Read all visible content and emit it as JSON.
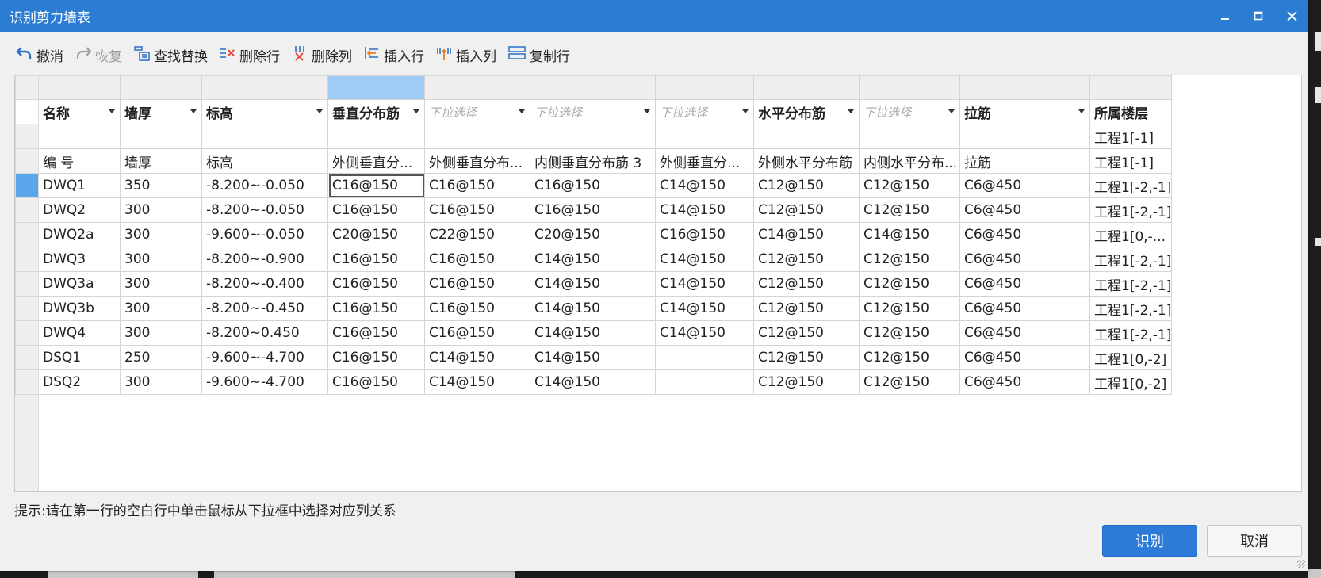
{
  "window": {
    "title": "识别剪力墙表",
    "controls": [
      "minimize-icon",
      "maximize-icon",
      "close-icon"
    ]
  },
  "toolbar": [
    {
      "label": "撤消",
      "icon": "undo-icon",
      "enabled": true
    },
    {
      "label": "恢复",
      "icon": "redo-icon",
      "enabled": false
    },
    {
      "label": "查找替换",
      "icon": "find-replace-icon",
      "enabled": true
    },
    {
      "label": "删除行",
      "icon": "delete-row-icon",
      "enabled": true
    },
    {
      "label": "删除列",
      "icon": "delete-column-icon",
      "enabled": true
    },
    {
      "label": "插入行",
      "icon": "insert-row-icon",
      "enabled": true
    },
    {
      "label": "插入列",
      "icon": "insert-column-icon",
      "enabled": true
    },
    {
      "label": "复制行",
      "icon": "copy-row-icon",
      "enabled": true
    }
  ],
  "table": {
    "mapping_row": [
      {
        "label": "名称",
        "placeholder": false
      },
      {
        "label": "墙厚",
        "placeholder": false
      },
      {
        "label": "标高",
        "placeholder": false
      },
      {
        "label": "垂直分布筋",
        "placeholder": false
      },
      {
        "label": "下拉选择",
        "placeholder": true
      },
      {
        "label": "下拉选择",
        "placeholder": true
      },
      {
        "label": "下拉选择",
        "placeholder": true
      },
      {
        "label": "水平分布筋",
        "placeholder": false
      },
      {
        "label": "下拉选择",
        "placeholder": true
      },
      {
        "label": "拉筋",
        "placeholder": false
      },
      {
        "label": "所属楼层",
        "placeholder": false,
        "no_dropdown": true
      }
    ],
    "blank_row": [
      "",
      "",
      "",
      "",
      "",
      "",
      "",
      "",
      "",
      "",
      "工程1[-1]"
    ],
    "source_header_row": [
      "编 号",
      "墙厚",
      "标高",
      "外侧垂直分...",
      "外侧垂直分布...",
      "内侧垂直分布筋 3",
      "外侧垂直分...",
      "外侧水平分布筋",
      "内侧水平分布...",
      "拉筋",
      "工程1[-1]"
    ],
    "rows": [
      [
        "DWQ1",
        "350",
        "-8.200~-0.050",
        "C16@150",
        "C16@150",
        "C16@150",
        "C14@150",
        "C12@150",
        "C12@150",
        "C6@450",
        "工程1[-2,-1]"
      ],
      [
        "DWQ2",
        "300",
        "-8.200~-0.050",
        "C16@150",
        "C16@150",
        "C16@150",
        "C14@150",
        "C12@150",
        "C12@150",
        "C6@450",
        "工程1[-2,-1]"
      ],
      [
        "DWQ2a",
        "300",
        "-9.600~-0.050",
        "C20@150",
        "C22@150",
        "C20@150",
        "C16@150",
        "C14@150",
        "C14@150",
        "C6@450",
        "工程1[0,-..."
      ],
      [
        "DWQ3",
        "300",
        "-8.200~-0.900",
        "C16@150",
        "C16@150",
        "C14@150",
        "C14@150",
        "C12@150",
        "C12@150",
        "C6@450",
        "工程1[-2,-1]"
      ],
      [
        "DWQ3a",
        "300",
        "-8.200~-0.400",
        "C16@150",
        "C16@150",
        "C14@150",
        "C14@150",
        "C12@150",
        "C12@150",
        "C6@450",
        "工程1[-2,-1]"
      ],
      [
        "DWQ3b",
        "300",
        "-8.200~-0.450",
        "C16@150",
        "C16@150",
        "C14@150",
        "C14@150",
        "C12@150",
        "C12@150",
        "C6@450",
        "工程1[-2,-1]"
      ],
      [
        "DWQ4",
        "300",
        "-8.200~0.450",
        "C16@150",
        "C16@150",
        "C14@150",
        "C14@150",
        "C12@150",
        "C12@150",
        "C6@450",
        "工程1[-2,-1]"
      ],
      [
        "DSQ1",
        "250",
        "-9.600~-4.700",
        "C16@150",
        "C14@150",
        "C14@150",
        "",
        "C12@150",
        "C12@150",
        "C6@450",
        "工程1[0,-2]"
      ],
      [
        "DSQ2",
        "300",
        "-9.600~-4.700",
        "C16@150",
        "C14@150",
        "C14@150",
        "",
        "C12@150",
        "C12@150",
        "C6@450",
        "工程1[0,-2]"
      ]
    ]
  },
  "hint": "提示:请在第一行的空白行中单击鼠标从下拉框中选择对应列关系",
  "buttons": {
    "ok": "识别",
    "cancel": "取消"
  },
  "colors": {
    "titlebar": "#2b7cd3",
    "primary_button": "#2d7bd8",
    "selected_header": "#9fccf5"
  }
}
